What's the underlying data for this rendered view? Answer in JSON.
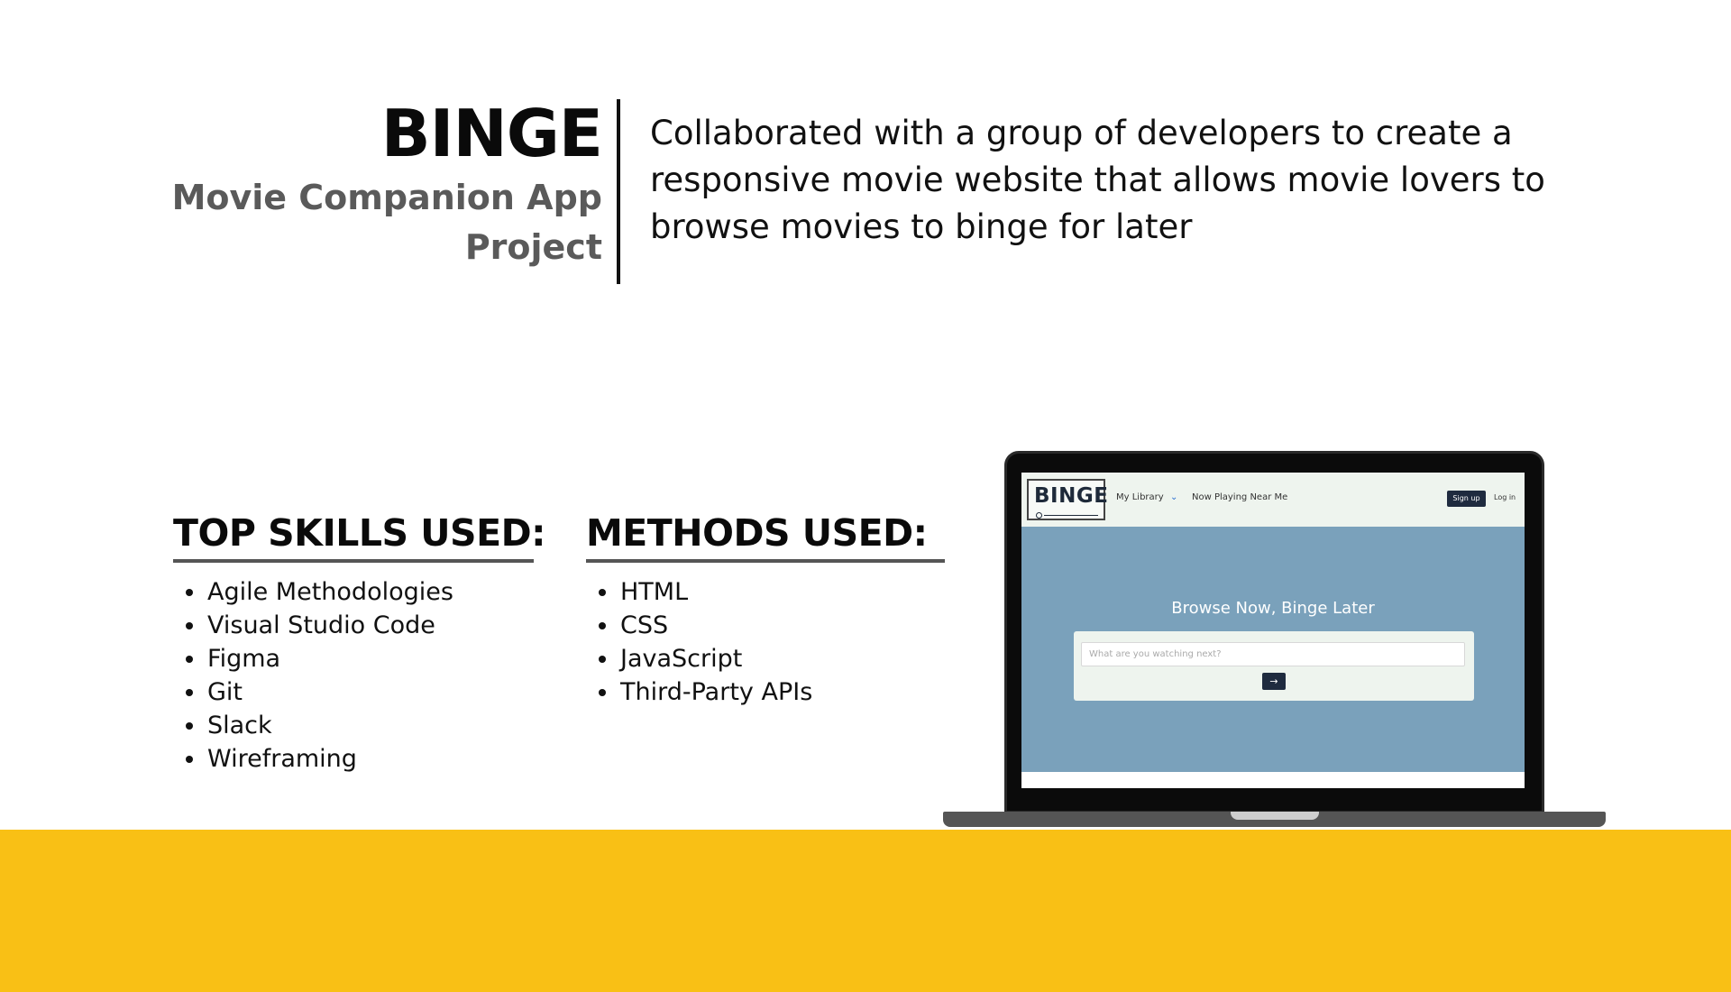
{
  "header": {
    "project_name": "BINGE",
    "subtitle_line1": "Movie Companion App",
    "subtitle_line2": "Project",
    "description": "Collaborated with a group of developers to create a responsive movie website that allows movie lovers to browse movies to binge for later"
  },
  "skills": {
    "title": "TOP SKILLS USED:",
    "items": [
      "Agile Methodologies",
      "Visual Studio Code",
      "Figma",
      "Git",
      "Slack",
      "Wireframing"
    ]
  },
  "methods": {
    "title": "METHODS USED:",
    "items": [
      "HTML",
      "CSS",
      "JavaScript",
      "Third-Party APIs"
    ]
  },
  "mockup": {
    "logo_text": "BINGE",
    "nav_library": "My Library",
    "nav_library_icon": "chevron-down-icon",
    "nav_now_playing": "Now Playing Near Me",
    "signup_label": "Sign up",
    "login_label": "Log in",
    "hero_title": "Browse Now, Binge Later",
    "search_placeholder": "What are you watching next?",
    "search_button_icon": "arrow-right-icon",
    "hero_color": "#7aa1bb",
    "nav_color": "#eef4ee"
  },
  "colors": {
    "accent_band": "#f9c015",
    "subtitle_gray": "#5a5a5a"
  }
}
